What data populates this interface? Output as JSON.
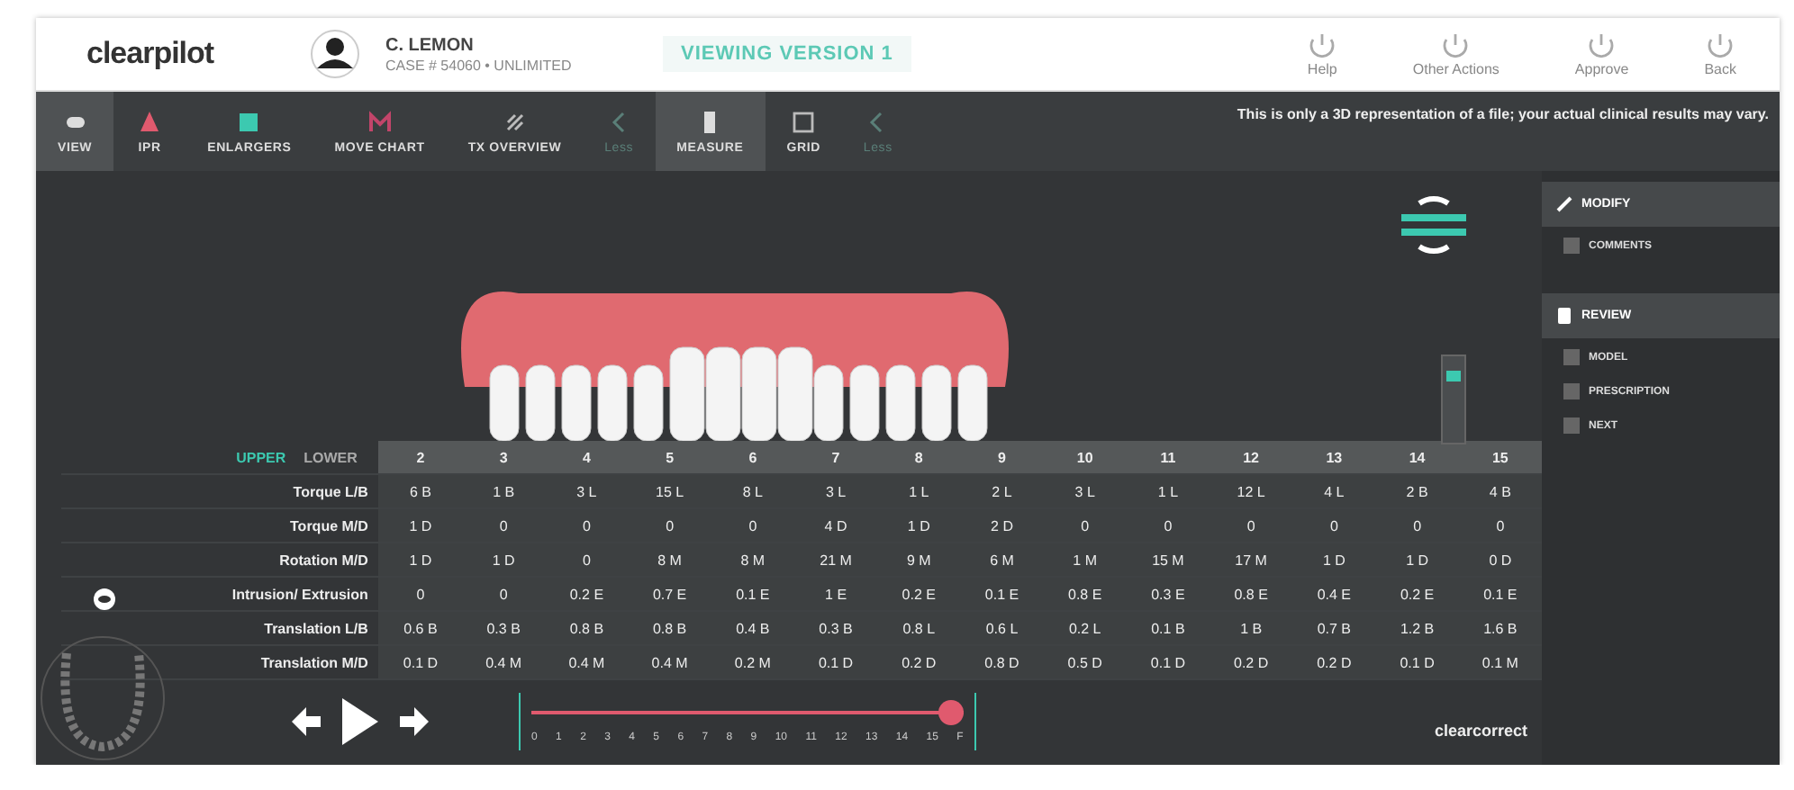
{
  "header": {
    "logo": "clearpilot",
    "patient_name": "C. LEMON",
    "case_info": "CASE # 54060 • UNLIMITED",
    "version": "VIEWING VERSION 1",
    "actions": [
      {
        "label": "Help"
      },
      {
        "label": "Other Actions"
      },
      {
        "label": "Approve"
      },
      {
        "label": "Back"
      }
    ]
  },
  "toolbar": {
    "tools": [
      {
        "label": "VIEW",
        "kind": "tool",
        "selected": true
      },
      {
        "label": "IPR",
        "kind": "tool",
        "selected": false
      },
      {
        "label": "ENLARGERS",
        "kind": "tool",
        "selected": false
      },
      {
        "label": "MOVE CHART",
        "kind": "tool",
        "selected": false
      },
      {
        "label": "TX OVERVIEW",
        "kind": "tool",
        "selected": false
      },
      {
        "label": "Less",
        "kind": "collapse",
        "selected": false
      },
      {
        "label": "MEASURE",
        "kind": "tool",
        "selected": true
      },
      {
        "label": "GRID",
        "kind": "tool",
        "selected": false
      },
      {
        "label": "Less",
        "kind": "collapse",
        "selected": false
      }
    ],
    "notice": "This is only a 3D representation of a file; your actual clinical results may vary."
  },
  "side_panel": {
    "sections": [
      {
        "label": "MODIFY",
        "items": [
          {
            "label": "COMMENTS"
          }
        ]
      },
      {
        "label": "REVIEW",
        "items": [
          {
            "label": "MODEL"
          },
          {
            "label": "PRESCRIPTION"
          },
          {
            "label": "NEXT"
          }
        ]
      }
    ]
  },
  "table": {
    "arches": [
      {
        "label": "UPPER",
        "selected": true
      },
      {
        "label": "LOWER",
        "selected": false
      }
    ],
    "columns": [
      "2",
      "3",
      "4",
      "5",
      "6",
      "7",
      "8",
      "9",
      "10",
      "11",
      "12",
      "13",
      "14",
      "15"
    ],
    "rows": [
      {
        "label": "Torque L/B",
        "cells": [
          "6 B",
          "1 B",
          "3 L",
          "15 L",
          "8 L",
          "3 L",
          "1 L",
          "2 L",
          "3 L",
          "1 L",
          "12 L",
          "4 L",
          "2 B",
          "4 B"
        ]
      },
      {
        "label": "Torque M/D",
        "cells": [
          "1 D",
          "0",
          "0",
          "0",
          "0",
          "4 D",
          "1 D",
          "2 D",
          "0",
          "0",
          "0",
          "0",
          "0",
          "0"
        ]
      },
      {
        "label": "Rotation M/D",
        "cells": [
          "1 D",
          "1 D",
          "0",
          "8 M",
          "8 M",
          "21 M",
          "9 M",
          "6 M",
          "1 M",
          "15 M",
          "17 M",
          "1 D",
          "1 D",
          "0 D"
        ]
      },
      {
        "label": "Intrusion/ Extrusion",
        "cells": [
          "0",
          "0",
          "0.2 E",
          "0.7 E",
          "0.1 E",
          "1 E",
          "0.2 E",
          "0.1 E",
          "0.8 E",
          "0.3 E",
          "0.8 E",
          "0.4 E",
          "0.2 E",
          "0.1 E"
        ]
      },
      {
        "label": "Translation L/B",
        "cells": [
          "0.6 B",
          "0.3 B",
          "0.8 B",
          "0.8 B",
          "0.4 B",
          "0.3 B",
          "0.8 L",
          "0.6 L",
          "0.2 L",
          "0.1 B",
          "1 B",
          "0.7 B",
          "1.2 B",
          "1.6 B"
        ]
      },
      {
        "label": "Translation M/D",
        "cells": [
          "0.1 D",
          "0.4 M",
          "0.4 M",
          "0.4 M",
          "0.2 M",
          "0.1 D",
          "0.2 D",
          "0.8 D",
          "0.5 D",
          "0.1 D",
          "0.2 D",
          "0.2 D",
          "0.1 D",
          "0.1 M"
        ]
      }
    ]
  },
  "timeline": {
    "ticks": [
      "0",
      "1",
      "2",
      "3",
      "4",
      "5",
      "6",
      "7",
      "8",
      "9",
      "10",
      "11",
      "12",
      "13",
      "14",
      "15",
      "F"
    ],
    "level": 1
  },
  "zoom_slider": {
    "level": 0.8
  },
  "footer_logo": "clearcorrect"
}
